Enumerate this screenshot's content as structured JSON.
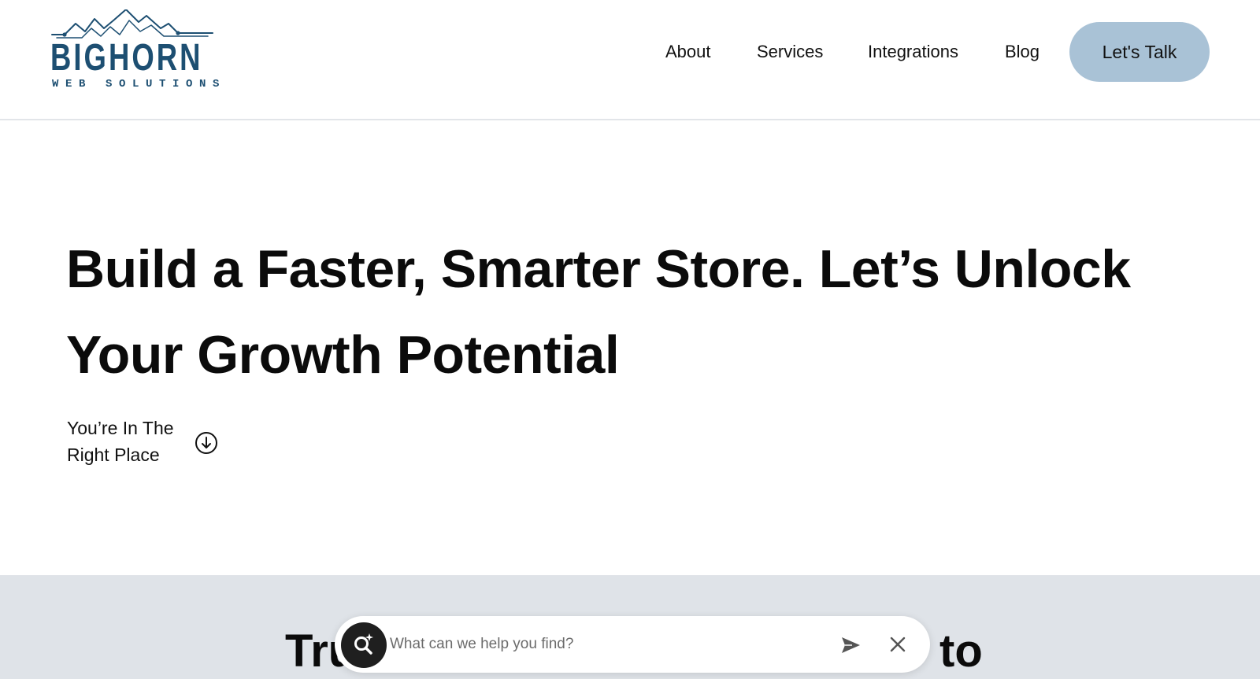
{
  "brand": {
    "name": "BIGHORN",
    "tagline": "WEB SOLUTIONS",
    "color": "#1d4f72"
  },
  "nav": {
    "items": [
      {
        "label": "About"
      },
      {
        "label": "Services"
      },
      {
        "label": "Integrations"
      },
      {
        "label": "Blog"
      }
    ],
    "cta_label": "Let's Talk",
    "cta_color": "#a9c2d6"
  },
  "hero": {
    "title": "Build a Faster, Smarter Store. Let’s Unlock Your Growth Potential",
    "subtitle": "You’re In The Right Place",
    "scroll_icon": "arrow-down-circle-icon"
  },
  "next_section": {
    "title_left_fragment": "Tru",
    "title_right_fragment": "to",
    "background": "#dfe3e8"
  },
  "search": {
    "placeholder": "What can we help you find?",
    "badge_icon": "ai-search-icon",
    "send_icon": "send-icon",
    "close_icon": "close-icon"
  }
}
